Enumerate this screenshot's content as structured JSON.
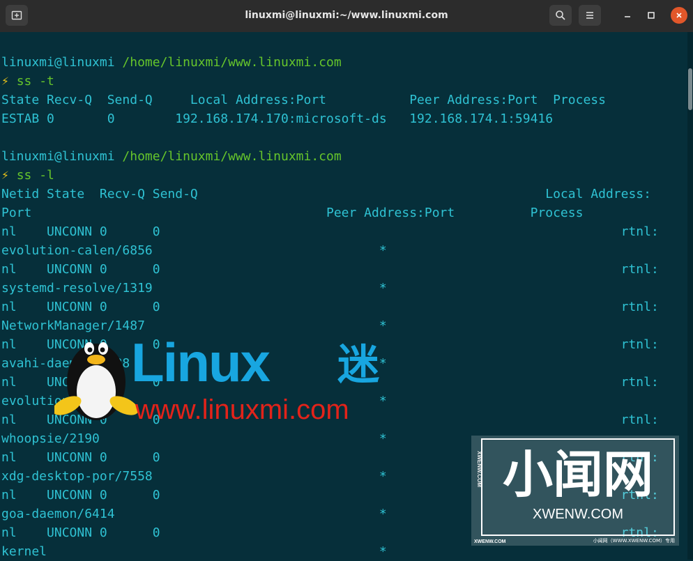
{
  "window": {
    "title": "linuxmi@linuxmi:~/www.linuxmi.com",
    "new_tab_icon": "new-tab-icon",
    "search_icon": "search-icon",
    "menu_icon": "hamburger-menu-icon"
  },
  "colors": {
    "terminal_bg": "#062f3a",
    "text_cyan": "#2fc2d3",
    "prompt_green": "#66c52b",
    "bolt_yellow": "#e8c21a",
    "close_orange": "#e2572a"
  },
  "terminal": {
    "prompt1": {
      "user": "linuxmi@linuxmi",
      "path": "/home/linuxmi/www.linuxmi.com",
      "symbol": "⚡",
      "command": "ss -t"
    },
    "ss_t_header": "State Recv-Q  Send-Q     Local Address:Port           Peer Address:Port  Process",
    "ss_t_row": "ESTAB 0       0        192.168.174.170:microsoft-ds   192.168.174.1:59416",
    "prompt2": {
      "user": "linuxmi@linuxmi",
      "path": "/home/linuxmi/www.linuxmi.com",
      "symbol": "⚡",
      "command": "ss -l"
    },
    "ss_l_header1": "Netid State  Recv-Q Send-Q                                              Local Address:",
    "ss_l_header2": "Port                                       Peer Address:Port          Process",
    "rows": [
      "nl    UNCONN 0      0                                                             rtnl:",
      "evolution-calen/6856                              *",
      "nl    UNCONN 0      0                                                             rtnl:",
      "systemd-resolve/1319                              *",
      "nl    UNCONN 0      0                                                             rtnl:",
      "NetworkManager/1487                               *",
      "nl    UNCONN 0      0                                                             rtnl:",
      "avahi-daemon/1488                                 *",
      "nl    UNCONN 0      0                                                             rtnl:",
      "evolution-/6874                                   *",
      "nl    UNCONN 0      0                                                             rtnl:",
      "whoopsie/2190                                     *",
      "nl    UNCONN 0      0                                                             rtnl:",
      "xdg-desktop-por/7558                              *",
      "nl    UNCONN 0      0                                                             rtnl:",
      "goa-daemon/6414                                   *",
      "nl    UNCONN 0      0                                                             rtnl:",
      "kernel                                            *"
    ]
  },
  "watermarks": {
    "linux": {
      "word": "Linux",
      "suffix": "迷",
      "url": "www.linuxmi.com"
    },
    "xwenw": {
      "logo": "小闻网",
      "site": "XWENW.COM",
      "side": "XWENW.COM",
      "bottom_left": "XWENW.COM",
      "bottom_right": "小闻网（WWW.XWENW.COM）专用"
    }
  }
}
